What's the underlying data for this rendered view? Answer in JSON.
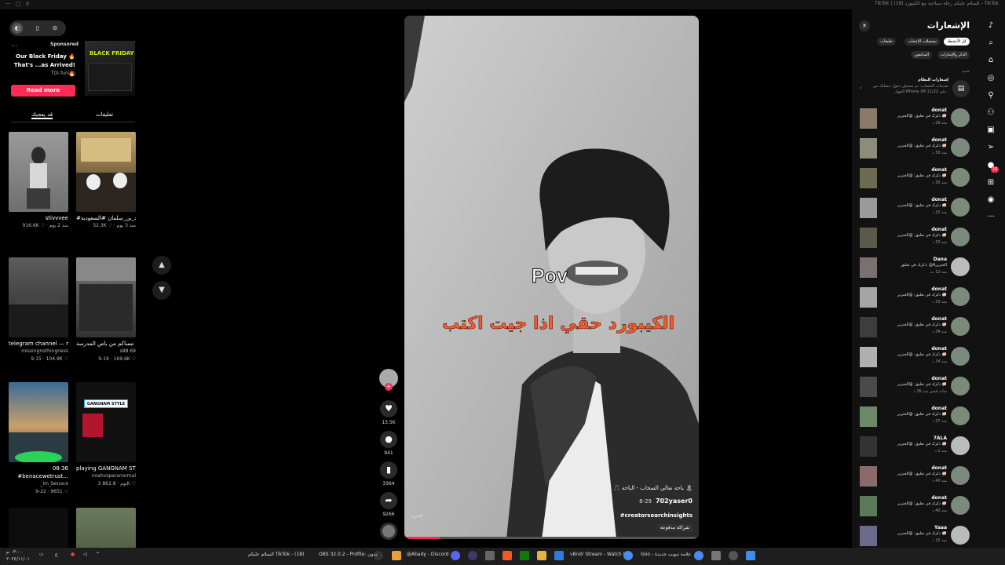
{
  "window": {
    "title": "TikTok | السلام عليكم رحلة سياحية مع الكيبورد (18) - TikTok",
    "controls": [
      "─",
      "□",
      "✕"
    ]
  },
  "left_panel": {
    "toolbar_icons": [
      "screen-icon",
      "mobile-icon",
      "settings-icon"
    ],
    "ad": {
      "dots": "...",
      "sponsored": "Sponsored",
      "title": "Our Black Friday 🔥 That's ...as Arrived! 🔥",
      "brand": "TDI-Tuning",
      "image_label": "BLACK FRIDAY",
      "button": "Read more"
    },
    "tabs": [
      "قد يعجبك",
      "تعليقات"
    ],
    "videos": [
      {
        "caption": "stivvvee",
        "meta": "916.6K ♡ · منذ 2 يوم"
      },
      {
        "caption": "#محمد_بن_سلمان #السعودية #SA #fyp",
        "meta": "52.3K ♡ · منذ 3 يوم"
      },
      {
        "caption": "telegram channel — msngbyss",
        "caption2": "missingnothingness",
        "meta": "9-15 · 104.9K ♡"
      },
      {
        "caption": "ويسد مساكم من باص المدرسة 🚌 ...",
        "caption2": "s88.69",
        "meta": "9-19 · 169.6K ♡"
      },
      {
        "caption": "08:36",
        "caption2": "#benacewetrust...",
        "caption3": "_im_benace",
        "meta": "9-22 · 9651 ♡"
      },
      {
        "caption": "playing GANGNAM STYLE inside of an",
        "caption2": "noahvsparanormal",
        "meta": "3 يوم · 862.8K ♡"
      }
    ],
    "gangnam_label": "GANGNAM STYLE"
  },
  "nav": {
    "up": "▲",
    "down": "▼"
  },
  "video": {
    "pov": "Pov",
    "overlay_text": "الكيبورد حقي اذا جيت اكتب",
    "music": "Midnight 🎵 ياحة تعالي السحاب - الباحة 🏝",
    "author": "702yaser0",
    "date": "8-29",
    "hashtag": "#creatorsearchinsights",
    "paid": "شراكة مدفوعة",
    "more": "المزيد",
    "progress": 0.12
  },
  "actions": [
    {
      "icon": "heart-icon",
      "glyph": "♥",
      "count": "13.5K"
    },
    {
      "icon": "comment-icon",
      "glyph": "●",
      "count": "941"
    },
    {
      "icon": "bookmark-icon",
      "glyph": "▮",
      "count": "3364"
    },
    {
      "icon": "share-icon",
      "glyph": "➦",
      "count": "9266"
    }
  ],
  "notifications": {
    "title": "الإشعارات",
    "close": "✕",
    "filters": [
      "كل الأنشطة",
      "تسجيلات الإعجاب",
      "تعليقات",
      "الذكر والإشارات",
      "المتابعون"
    ],
    "new_label": "جديد",
    "system": {
      "title": "إشعارات النظام",
      "text": "تحديثات الحساب: تم تسجيل دخول حسابك من الجهاز iPhone XR في 11/22..."
    },
    "items": [
      {
        "name": "donat",
        "msg": "ذكرك في تعليق: @الخنزير 🐖",
        "time": "منذ 29 د"
      },
      {
        "name": "donat",
        "msg": "ذكرك في تعليق: @الخنزير 🐖",
        "time": "منذ 30 د"
      },
      {
        "name": "donat",
        "msg": "ذكرك في تعليق: @الخنزير 🐖",
        "time": "منذ 30 د"
      },
      {
        "name": "donat",
        "msg": "ذكرك في تعليق: @الخنزير 🐖",
        "time": "منذ 32 د"
      },
      {
        "name": "donat",
        "msg": "ذكرك في تعليق: @الخنزير 🐖",
        "time": "منذ 33 د"
      },
      {
        "name": "Dana",
        "msg": "ذكرك في تعليق: @Aالخنزير",
        "time": "منذ 12 ث"
      },
      {
        "name": "donat",
        "msg": "ذكرك في تعليق: @الخنزير 🐖",
        "time": "منذ 33 د"
      },
      {
        "name": "donat",
        "msg": "ذكرك في تعليق: @الخنزير 🐖",
        "time": "منذ 34 د"
      },
      {
        "name": "donat",
        "msg": "ذكرك في تعليق: @الخنزير 🐖",
        "time": "منذ 34 د"
      },
      {
        "name": "donat",
        "msg": "ذكرك في تعليق: @الخنزير 🐖",
        "time": "شات قبس منذ 36 د"
      },
      {
        "name": "donat",
        "msg": "ذكرك في تعليق: @الخنزير 🐖",
        "time": "منذ 37 د"
      },
      {
        "name": "7ALA",
        "msg": "ذكرك في تعليق: @الخنزير 🐖",
        "time": "منذ 1 د"
      },
      {
        "name": "donat",
        "msg": "ذكرك في تعليق: @الخنزير 🐖",
        "time": "منذ 40 د"
      },
      {
        "name": "donat",
        "msg": "ذكرك في تعليق: @الخنزير 🐖",
        "time": "منذ 40 د"
      },
      {
        "name": "Yaaa",
        "msg": "ذكرك في تعليق: @الخنزير 🐖",
        "time": "منذ 15 د"
      }
    ]
  },
  "sidebar_icons": [
    {
      "name": "tiktok-logo-icon",
      "glyph": "♪"
    },
    {
      "name": "search-icon",
      "glyph": "⌕"
    },
    {
      "name": "home-icon",
      "glyph": "⌂"
    },
    {
      "name": "explore-icon",
      "glyph": "◎"
    },
    {
      "name": "following-icon",
      "glyph": "⚲"
    },
    {
      "name": "friends-icon",
      "glyph": "⚇"
    },
    {
      "name": "live-icon",
      "glyph": "▣"
    },
    {
      "name": "messages-icon",
      "glyph": "➢"
    },
    {
      "name": "activity-icon",
      "glyph": "●"
    },
    {
      "name": "upload-icon",
      "glyph": "⊞"
    },
    {
      "name": "profile-icon",
      "glyph": "◉"
    },
    {
      "name": "more-icon",
      "glyph": "···"
    }
  ],
  "activity_badge": "10",
  "taskbar": {
    "clock_time": "٠٣:٠٠ م",
    "clock_date": "٢٠٢٤/١١/٠١",
    "apps": [
      "السلام عليكم TikTok - (18)",
      "OBS 32.0.2 - Profile: بدون",
      "@Abady - Discord",
      "v8ndr Stream - Watch L...",
      "Goo - علامة تبويب جديدة"
    ]
  },
  "colors": {
    "accent": "#fe2c55",
    "panel": "#121212",
    "bg": "#000000"
  }
}
